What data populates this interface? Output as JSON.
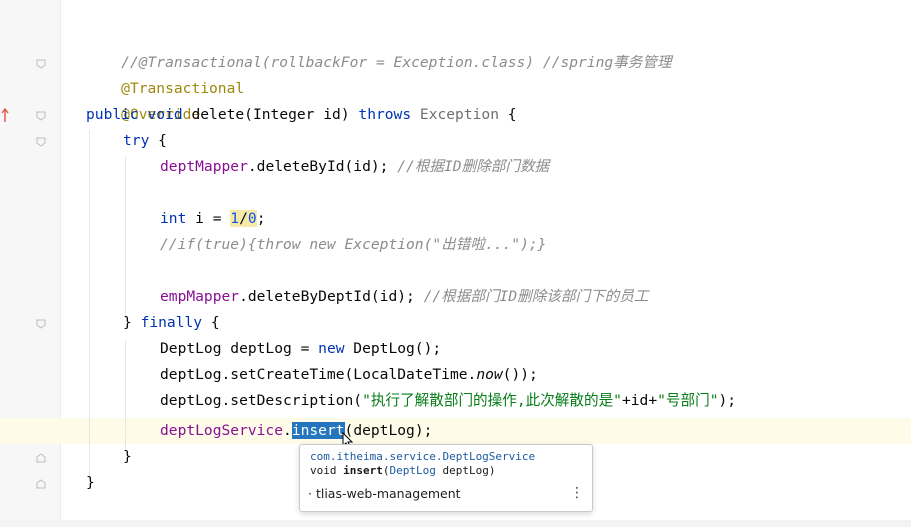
{
  "editor": {
    "lines": {
      "l1": "//@Transactional(rollbackFor = Exception.class) //spring事务管理",
      "l2": "@Transactional",
      "l3": "@Override",
      "l4": {
        "public": "public",
        "void": "void",
        "name": " delete(Integer id) ",
        "throws": "throws",
        "exc": " Exception",
        "brace": " {"
      },
      "l5": {
        "try": "try",
        "brace": " {"
      },
      "l6": {
        "field": "deptMapper",
        "call": ".deleteById(id); ",
        "comment": "//根据ID删除部门数据"
      },
      "l8": {
        "int": "int",
        "mid": " i = ",
        "num1": "1",
        "slash": "/",
        "num2": "0",
        "end": ";"
      },
      "l9": "//if(true){throw new Exception(\"出错啦...\");}",
      "l11": {
        "field": "empMapper",
        "call": ".deleteByDeptId(id); ",
        "comment": "//根据部门ID删除该部门下的员工"
      },
      "l12": {
        "close": "} ",
        "finally": "finally",
        "brace": " {"
      },
      "l13": {
        "pre": "DeptLog deptLog = ",
        "new": "new",
        "post": " DeptLog();"
      },
      "l14": {
        "pre": "deptLog.setCreateTime(LocalDateTime.",
        "now": "now",
        "post": "());"
      },
      "l15": {
        "pre": "deptLog.setDescription(",
        "str1": "\"执行了解散部门的操作,此次解散的是\"",
        "mid": "+id+",
        "str2": "\"号部门\"",
        "post": ");"
      },
      "l16": {
        "field": "deptLogService",
        "dot": ".",
        "method": "insert",
        "post": "(deptLog);"
      },
      "l17": "}",
      "l18": "}"
    }
  },
  "popup": {
    "package": "com.itheima.service.DeptLogService",
    "sig_void": "void ",
    "sig_name": "insert",
    "sig_open": "(",
    "sig_type": "DeptLog",
    "sig_param": " deptLog)",
    "module": "· tlias-web-management",
    "more_icon": "⋮"
  },
  "colors": {
    "keyword": "#0033b3",
    "annotation": "#9e880d",
    "field": "#871094",
    "string": "#067d17",
    "comment": "#8c8c8c",
    "number": "#1750eb",
    "selection": "#2675bf"
  }
}
